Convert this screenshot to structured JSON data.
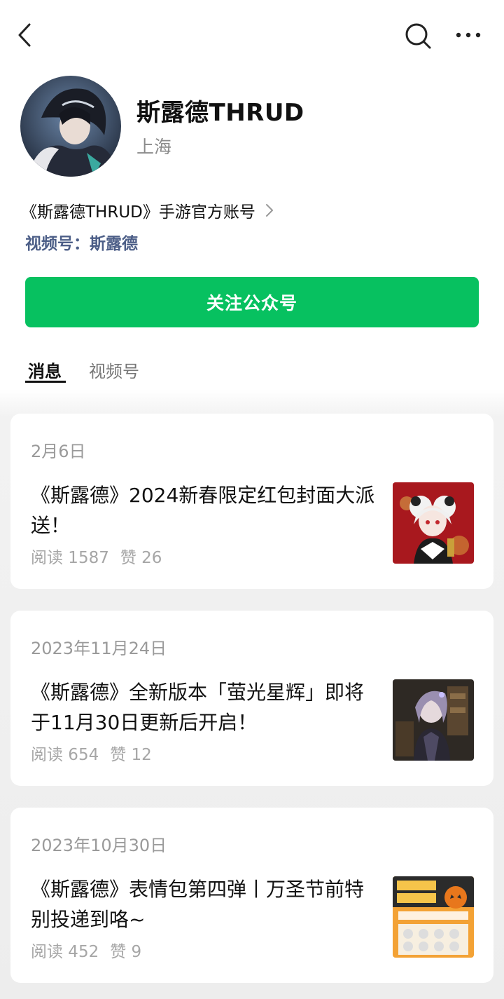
{
  "topbar": {
    "back_icon": "chevron-left-icon",
    "search_icon": "search-icon",
    "more_icon": "more-dots-icon"
  },
  "profile": {
    "name": "斯露德THRUD",
    "location": "上海",
    "description": "《斯露德THRUD》手游官方账号",
    "channel_link": "视频号：斯露德",
    "follow_label": "关注公众号",
    "accent_color": "#07c160",
    "link_color": "#4c5e87"
  },
  "tabs": [
    {
      "label": "消息",
      "active": true
    },
    {
      "label": "视频号",
      "active": false
    }
  ],
  "articles": [
    {
      "date": "2月6日",
      "title": "《斯露德》2024新春限定红包封面大派送！",
      "reads": "阅读 1587",
      "likes": "赞 26"
    },
    {
      "date": "2023年11月24日",
      "title": "《斯露德》全新版本「萤光星辉」即将于11月30日更新后开启！",
      "reads": "阅读 654",
      "likes": "赞 12"
    },
    {
      "date": "2023年10月30日",
      "title": "《斯露德》表情包第四弹丨万圣节前特别投递到咯~",
      "reads": "阅读 452",
      "likes": "赞 9"
    }
  ]
}
